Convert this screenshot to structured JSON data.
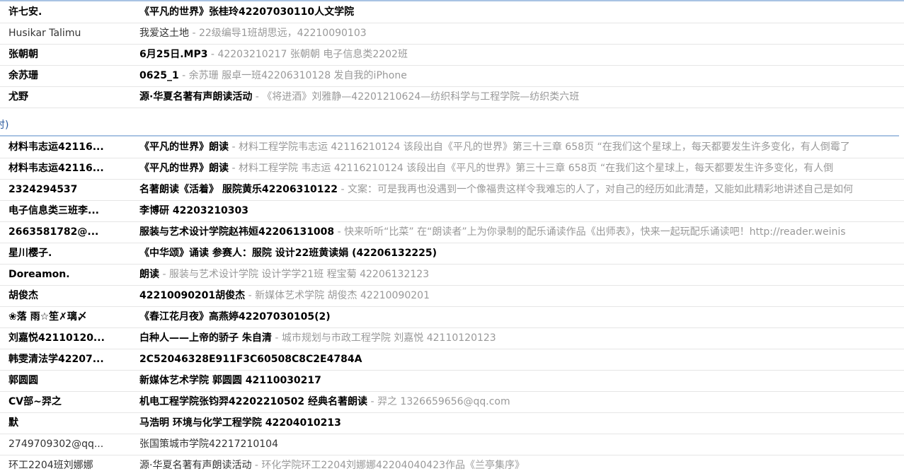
{
  "group_header": "时)",
  "rows_top": [
    {
      "sender": "许七安.",
      "subject": "《平凡的世界》张桂玲42207030110人文学院",
      "preview": "",
      "unread": true
    },
    {
      "sender": "Husikar Talimu",
      "subject": "我爱这土地",
      "preview": "22级编导1班胡思远，42210090103",
      "unread": false
    },
    {
      "sender": "张朝朝",
      "subject": "6月25日.MP3",
      "preview": "42203210217 张朝朝 电子信息类2202班",
      "unread": true
    },
    {
      "sender": "余苏珊",
      "subject": "0625_1",
      "preview": "余苏珊 服卓一班42206310128 发自我的iPhone",
      "unread": true
    },
    {
      "sender": "尤野",
      "subject": "源·华夏名著有声朗读活动",
      "preview": "《将进酒》刘雅静—42201210624—纺织科学与工程学院—纺织类六班",
      "unread": true
    }
  ],
  "rows_bottom": [
    {
      "sender": "材料韦志运42116...",
      "subject": "《平凡的世界》朗读",
      "preview": "材料工程学院韦志运 42116210124   该段出自《平凡的世界》第三十三章 658页 “在我们这个星球上，每天都要发生许多变化，有人倒霉了",
      "unread": true
    },
    {
      "sender": "材料韦志运42116...",
      "subject": "《平凡的世界》朗读",
      "preview": "材料工程学院   韦志运    42116210124    该段出自《平凡的世界》第三十三章 658页 “在我们这个星球上，每天都要发生许多变化，有人倒",
      "unread": true
    },
    {
      "sender": "2324294537",
      "subject": "名著朗读《活着》 服院黄乐42206310122",
      "preview": "文案：可是我再也没遇到一个像福贵这样令我难忘的人了，对自己的经历如此清楚，又能如此精彩地讲述自己是如何",
      "unread": true
    },
    {
      "sender": "电子信息类三班李...",
      "subject": "李博研  42203210303",
      "preview": "",
      "unread": true
    },
    {
      "sender": "2663581782@...",
      "subject": "服装与艺术设计学院赵祎姮42206131008",
      "preview": "快来听听“比菜” 在“朗读者”上为你录制的配乐诵读作品《出师表》，快来一起玩配乐诵读吧！http://reader.weinis",
      "unread": true
    },
    {
      "sender": "星川樱子.",
      "subject": "《中华颂》诵读   参赛人：服院 设计22班黄读娟 (42206132225)",
      "preview": "",
      "unread": true
    },
    {
      "sender": "Doreamon.",
      "subject": "朗读",
      "preview": "服装与艺术设计学院 设计学学21班 程宝菊 42206132123",
      "unread": true
    },
    {
      "sender": "胡俊杰",
      "subject": "42210090201胡俊杰",
      "preview": "新媒体艺术学院 胡俊杰 42210090201",
      "unread": true
    },
    {
      "sender": "❀落 雨☆笙✗璃〆",
      "subject": "《春江花月夜》高燕婷42207030105(2)",
      "preview": "",
      "unread": true
    },
    {
      "sender": "刘嘉悦42110120...",
      "subject": "白种人——上帝的骄子  朱自清",
      "preview": "城市规划与市政工程学院 刘嘉悦 42110120123",
      "unread": true
    },
    {
      "sender": "韩雯清法学42207...",
      "subject": "2C52046328E911F3C60508C8C2E4784A",
      "preview": "",
      "unread": true
    },
    {
      "sender": "郭圆圆",
      "subject": "新媒体艺术学院 郭圆圆 42110030217",
      "preview": "",
      "unread": true
    },
    {
      "sender": "CV部~羿之",
      "subject": "机电工程学院张钧羿42202210502 经典名著朗读",
      "preview": "羿之 1326659656@qq.com",
      "unread": true
    },
    {
      "sender": "默",
      "subject": "马浩明    环境与化学工程学院     42204010213",
      "preview": "",
      "unread": true
    },
    {
      "sender": "2749709302@qq...",
      "subject": "张国策城市学院42217210104",
      "preview": "",
      "unread": false
    },
    {
      "sender": "环工2204班刘娜娜",
      "subject": "源·华夏名著有声朗读活动",
      "preview": "环化学院环工2204刘娜娜42204040423作品《兰亭集序》",
      "unread": false
    }
  ]
}
